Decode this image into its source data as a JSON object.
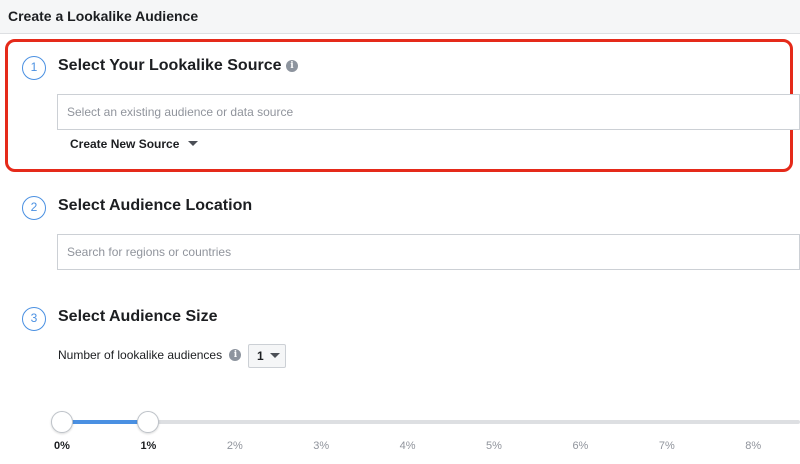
{
  "header": {
    "title": "Create a Lookalike Audience"
  },
  "sections": [
    {
      "number": "1",
      "title": "Select Your Lookalike Source",
      "placeholder": "Select an existing audience or data source",
      "link_label": "Create New Source"
    },
    {
      "number": "2",
      "title": "Select Audience Location",
      "placeholder": "Search for regions or countries"
    },
    {
      "number": "3",
      "title": "Select Audience Size",
      "count_label": "Number of lookalike audiences",
      "count_value": "1"
    }
  ],
  "slider": {
    "min_percent": 0,
    "max_percent": 1,
    "ticks": [
      "0%",
      "1%",
      "2%",
      "3%",
      "4%",
      "5%",
      "6%",
      "7%",
      "8%"
    ]
  },
  "colors": {
    "accent": "#4a90e2",
    "highlight": "#e52a1a",
    "header_bg": "#f5f6f7"
  },
  "icons": {
    "info": "info-icon",
    "dropdown": "caret-down-icon"
  }
}
